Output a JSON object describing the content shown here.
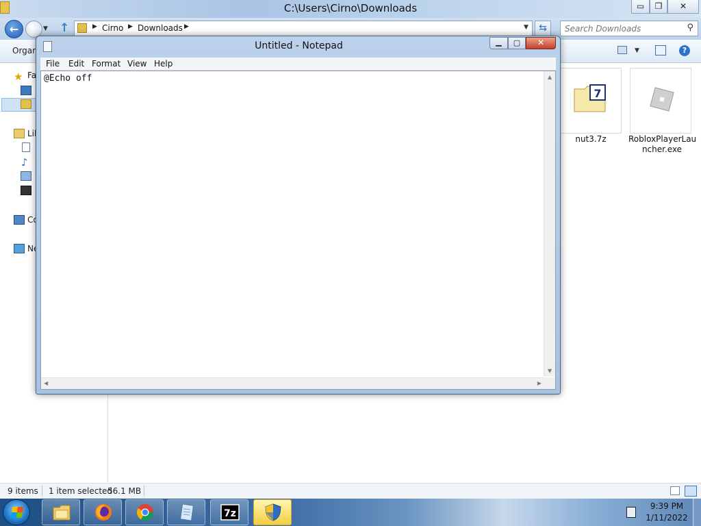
{
  "explorer": {
    "title": "C:\\Users\\Cirno\\Downloads",
    "window_controls": {
      "minimize": "▭",
      "maximize": "❐",
      "close": "✕"
    },
    "breadcrumb": [
      "Cirno",
      "Downloads"
    ],
    "search_placeholder": "Search Downloads",
    "toolbar": {
      "organize": "Organ"
    },
    "nav_pane": [
      {
        "icon": "star-icon",
        "label": "Fa"
      },
      {
        "icon": "desktop-icon",
        "label": ""
      },
      {
        "icon": "downloads-folder-icon",
        "label": ""
      },
      {
        "icon": "libraries-icon",
        "label": "Lil"
      },
      {
        "icon": "documents-icon",
        "label": ""
      },
      {
        "icon": "music-icon",
        "label": ""
      },
      {
        "icon": "pictures-icon",
        "label": ""
      },
      {
        "icon": "videos-icon",
        "label": ""
      },
      {
        "icon": "computer-icon",
        "label": "Co"
      },
      {
        "icon": "network-icon",
        "label": "Ne"
      }
    ],
    "files": [
      {
        "name": "nut3.7z",
        "icon": "7z-archive-icon"
      },
      {
        "name": "RobloxPlayerLauncher.exe",
        "name_lines": [
          "RobloxPlayerLau",
          "ncher.exe"
        ],
        "icon": "roblox-icon"
      }
    ],
    "status": {
      "items": "9 items",
      "selected": "1 item selected",
      "size": "56.1 MB"
    }
  },
  "notepad": {
    "title": "Untitled - Notepad",
    "window_controls": {
      "minimize": "▁",
      "maximize": "▢",
      "close": "✕"
    },
    "menu": [
      "File",
      "Edit",
      "Format",
      "View",
      "Help"
    ],
    "content": "@Echo off"
  },
  "taskbar": {
    "apps": [
      {
        "name": "file-explorer",
        "icon": "folder-icon"
      },
      {
        "name": "firefox",
        "icon": "firefox-icon"
      },
      {
        "name": "chrome",
        "icon": "chrome-icon"
      },
      {
        "name": "notepad",
        "icon": "notepad-icon"
      },
      {
        "name": "7-zip",
        "icon": "7zip-icon",
        "label": "7z"
      },
      {
        "name": "user-account-control",
        "icon": "shield-icon",
        "active": true
      }
    ],
    "clock": {
      "time": "9:39 PM",
      "date": "1/11/2022"
    }
  },
  "colors": {
    "accent": "#2f73c9",
    "notepad_close": "#c6402a",
    "taskbar_active": "#f1cd42"
  }
}
